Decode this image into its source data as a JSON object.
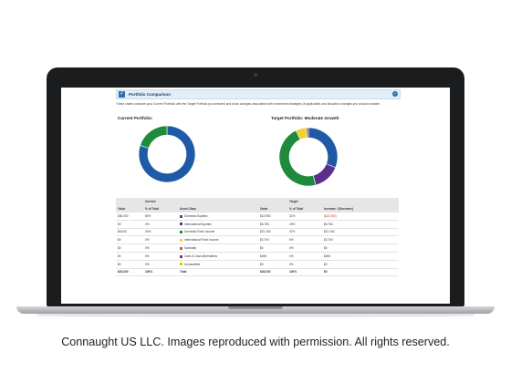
{
  "panel": {
    "title": "Portfolio Comparison",
    "check_icon": "check-icon",
    "collapse_icon": "minus-circle-icon",
    "description": "These charts compare your Current Portfolio with the Target Portfolio you selected and show changes associated with investment strategies (if applicable) and allocation changes you should consider."
  },
  "current_chart": {
    "title": "Current Portfolio:",
    "chart_data": {
      "type": "pie",
      "categories": [
        "Domestic Equities",
        "Domestic Fixed Income"
      ],
      "values": [
        80,
        20
      ],
      "colors": [
        "#1f5aa6",
        "#1e8a3c"
      ]
    }
  },
  "target_chart": {
    "title": "Target Portfolio: Moderate Growth",
    "chart_data": {
      "type": "pie",
      "categories": [
        "Domestic Equities",
        "International Equities",
        "Domestic Fixed Income",
        "International Fixed Income",
        "Specialty",
        "Cash & Cash Alternatives"
      ],
      "values": [
        31,
        15,
        47,
        6,
        0,
        1
      ],
      "colors": [
        "#1f5aa6",
        "#5b2d8e",
        "#1e8a3c",
        "#f2d22e",
        "#d9534f",
        "#8e2d6b"
      ]
    }
  },
  "table": {
    "group_current": "Current",
    "group_target": "Target",
    "headers": [
      "Value",
      "% of Total",
      "Asset Class",
      "Value",
      "% of Total",
      "Increase / (Decrease)"
    ],
    "rows": [
      {
        "cur_value": "$36,000",
        "cur_pct": "80%",
        "asset": "Domestic Equities",
        "color": "#1f5aa6",
        "tgt_value": "$13,950",
        "tgt_pct": "31%",
        "change": "($22,050)",
        "negative": true
      },
      {
        "cur_value": "$0",
        "cur_pct": "0%",
        "asset": "International Equities",
        "color": "#5b2d8e",
        "tgt_value": "$6,750",
        "tgt_pct": "15%",
        "change": "$6,750",
        "negative": false
      },
      {
        "cur_value": "$9,000",
        "cur_pct": "20%",
        "asset": "Domestic Fixed Income",
        "color": "#1e8a3c",
        "tgt_value": "$21,150",
        "tgt_pct": "47%",
        "change": "$12,150",
        "negative": false
      },
      {
        "cur_value": "$0",
        "cur_pct": "0%",
        "asset": "International Fixed Income",
        "color": "#f2d22e",
        "tgt_value": "$2,700",
        "tgt_pct": "6%",
        "change": "$2,700",
        "negative": false
      },
      {
        "cur_value": "$0",
        "cur_pct": "0%",
        "asset": "Specialty",
        "color": "#d9534f",
        "tgt_value": "$0",
        "tgt_pct": "0%",
        "change": "$0",
        "negative": false
      },
      {
        "cur_value": "$0",
        "cur_pct": "0%",
        "asset": "Cash & Cash Alternatives",
        "color": "#8e2d6b",
        "tgt_value": "$450",
        "tgt_pct": "1%",
        "change": "$450",
        "negative": false
      },
      {
        "cur_value": "$0",
        "cur_pct": "0%",
        "asset": "Unclassified",
        "color": "#c8d400",
        "tgt_value": "$0",
        "tgt_pct": "0%",
        "change": "$0",
        "negative": false
      }
    ],
    "total": {
      "cur_value": "$45,000",
      "cur_pct": "100%",
      "asset": "Total",
      "tgt_value": "$45,000",
      "tgt_pct": "100%",
      "change": "$0"
    }
  },
  "caption": "Connaught US LLC. Images reproduced with permission. All rights reserved."
}
